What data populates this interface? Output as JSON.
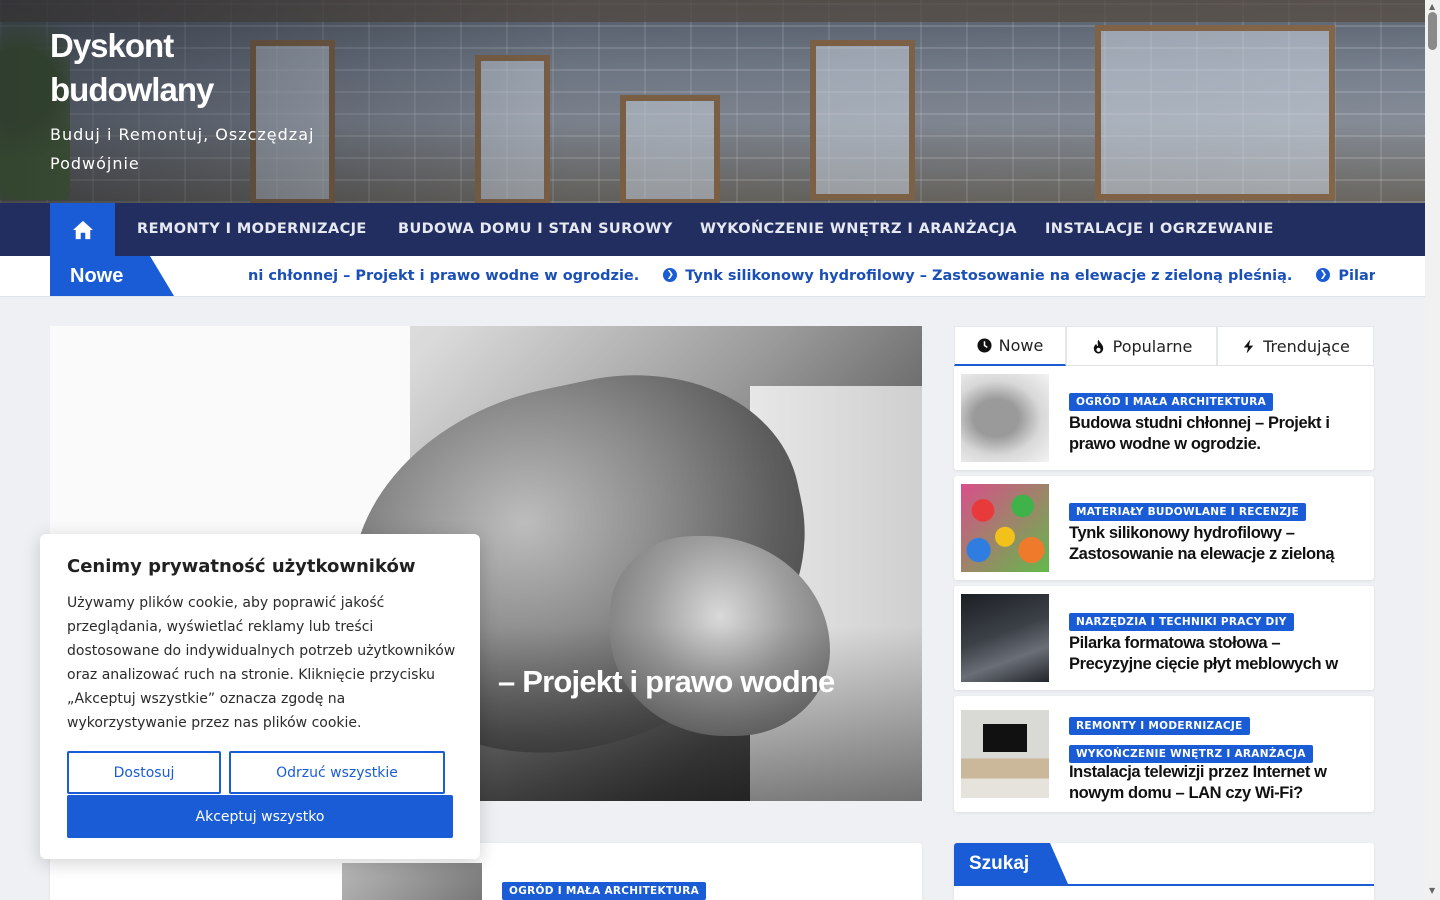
{
  "colors": {
    "primary": "#1a5cd6",
    "nav_bg": "#222e5f",
    "page_bg": "#eef0f4"
  },
  "site": {
    "title": "Dyskont budowlany",
    "description": "Buduj i Remontuj, Oszczędzaj Podwójnie"
  },
  "nav": {
    "home_icon": "home-icon",
    "items": [
      "REMONTY I MODERNIZACJE",
      "BUDOWA DOMU I STAN SUROWY",
      "WYKOŃCZENIE WNĘTRZ I ARANŻACJA",
      "INSTALACJE I OGRZEWANIE"
    ]
  },
  "ticker": {
    "label": "Nowe",
    "items": [
      "ni chłonnej – Projekt i prawo wodne w ogrodzie.",
      "Tynk silikonowy hydrofilowy – Zastosowanie na elewacje z zieloną pleśnią.",
      "Pilarka f"
    ]
  },
  "hero": {
    "title_visible": "– Projekt i prawo wodne"
  },
  "post": {
    "category": "OGRÓD I MAŁA ARCHITEKTURA"
  },
  "tabs": [
    {
      "label": "Nowe",
      "icon": "clock-icon"
    },
    {
      "label": "Popularne",
      "icon": "flame-icon"
    },
    {
      "label": "Trendujące",
      "icon": "bolt-icon"
    }
  ],
  "side_posts": [
    {
      "categories": [
        "OGRÓD I MAŁA ARCHITEKTURA"
      ],
      "title": "Budowa studni chłonnej – Projekt i prawo wodne w ogrodzie."
    },
    {
      "categories": [
        "MATERIAŁY BUDOWLANE I RECENZJE"
      ],
      "title": "Tynk silikonowy hydrofilowy – Zastosowanie na elewacje z zieloną pleśnią."
    },
    {
      "categories": [
        "NARZĘDZIA I TECHNIKI PRACY DIY"
      ],
      "title": "Pilarka formatowa stołowa – Precyzyjne cięcie płyt meblowych w warsztacie."
    },
    {
      "categories": [
        "REMONTY I MODERNIZACJE",
        "WYKOŃCZENIE WNĘTRZ I ARANŻACJA"
      ],
      "title": "Instalacja telewizji przez Internet w nowym domu – LAN czy Wi-Fi?"
    }
  ],
  "search": {
    "title": "Szukaj"
  },
  "cookie": {
    "title": "Cenimy prywatność użytkowników",
    "text": "Używamy plików cookie, aby poprawić jakość przeglądania, wyświetlać reklamy lub treści dostosowane do indywidualnych potrzeb użytkowników oraz analizować ruch na stronie. Kliknięcie przycisku „Akceptuj wszystkie” oznacza zgodę na wykorzystywanie przez nas plików cookie.",
    "customize": "Dostosuj",
    "reject": "Odrzuć wszystkie",
    "accept": "Akceptuj wszystko"
  }
}
